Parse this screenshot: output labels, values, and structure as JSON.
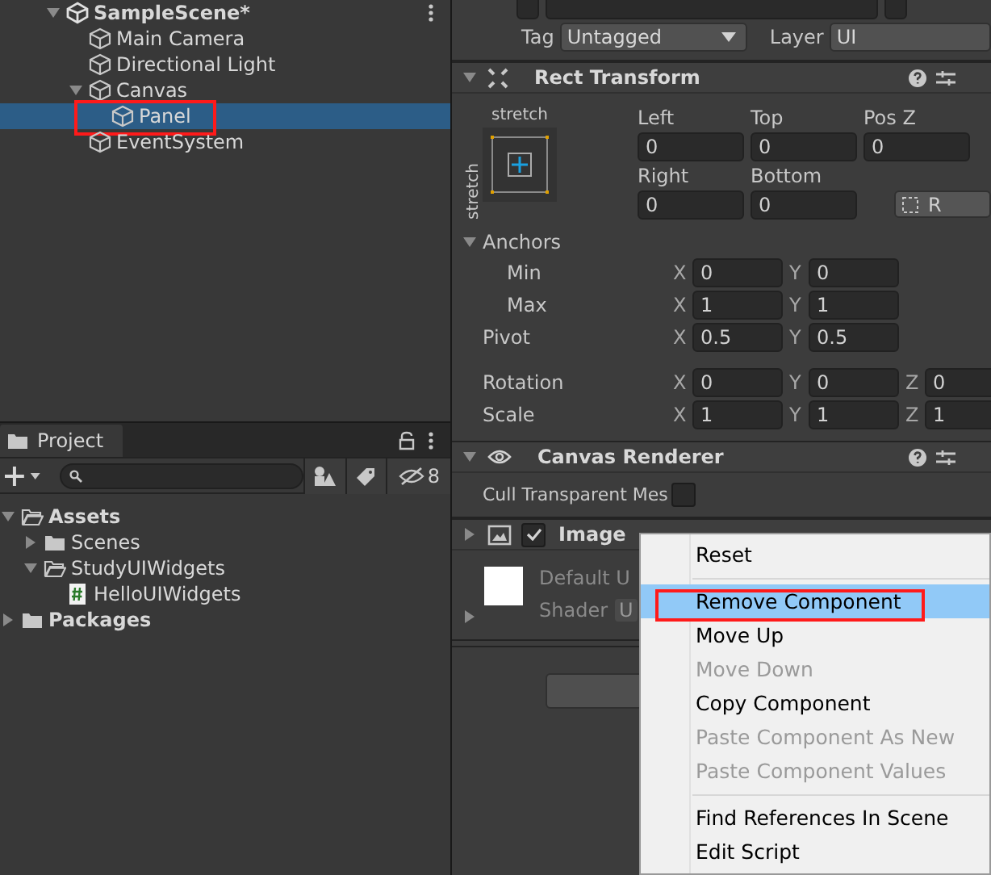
{
  "hierarchy": {
    "items": [
      {
        "name": "SampleScene*",
        "kind": "scene",
        "expanded": true,
        "selected": false,
        "annotated": false,
        "children": [
          {
            "name": "Main Camera",
            "kind": "object",
            "selected": false,
            "annotated": false
          },
          {
            "name": "Directional Light",
            "kind": "object",
            "selected": false,
            "annotated": false
          },
          {
            "name": "Canvas",
            "kind": "object",
            "expanded": true,
            "selected": false,
            "annotated": false,
            "children": [
              {
                "name": "Panel",
                "kind": "object",
                "selected": true,
                "annotated": true
              }
            ]
          },
          {
            "name": "EventSystem",
            "kind": "object",
            "selected": false,
            "annotated": false
          }
        ]
      }
    ]
  },
  "project": {
    "tab": "Project",
    "hidden_count": "8",
    "items": [
      {
        "name": "Assets",
        "kind": "folder",
        "expanded": true,
        "bold": true,
        "children": [
          {
            "name": "Scenes",
            "kind": "folder",
            "expanded": false,
            "bold": false
          },
          {
            "name": "StudyUIWidgets",
            "kind": "folder",
            "expanded": true,
            "bold": false,
            "children": [
              {
                "name": "HelloUIWidgets",
                "kind": "script",
                "bold": false
              }
            ]
          }
        ]
      },
      {
        "name": "Packages",
        "kind": "folder",
        "expanded": false,
        "bold": true
      }
    ]
  },
  "inspector": {
    "tag": {
      "label": "Tag",
      "value": "Untagged"
    },
    "layer": {
      "label": "Layer",
      "value": "UI"
    },
    "rect_transform": {
      "title": "Rect Transform",
      "expanded": true,
      "preset_top": "stretch",
      "preset_side": "stretch",
      "position_rows": [
        [
          {
            "label": "Left",
            "value": "0"
          },
          {
            "label": "Top",
            "value": "0"
          },
          {
            "label": "Pos Z",
            "value": "0"
          }
        ],
        [
          {
            "label": "Right",
            "value": "0"
          },
          {
            "label": "Bottom",
            "value": "0"
          }
        ]
      ],
      "raw_button": "R",
      "anchors": {
        "label": "Anchors",
        "expanded": true,
        "rows": [
          {
            "label": "Min",
            "fields": [
              {
                "axis": "X",
                "value": "0"
              },
              {
                "axis": "Y",
                "value": "0"
              }
            ]
          },
          {
            "label": "Max",
            "fields": [
              {
                "axis": "X",
                "value": "1"
              },
              {
                "axis": "Y",
                "value": "1"
              }
            ]
          }
        ]
      },
      "vectors": [
        {
          "label": "Pivot",
          "fields": [
            {
              "axis": "X",
              "value": "0.5"
            },
            {
              "axis": "Y",
              "value": "0.5"
            }
          ]
        },
        {
          "label": "Rotation",
          "fields": [
            {
              "axis": "X",
              "value": "0"
            },
            {
              "axis": "Y",
              "value": "0"
            },
            {
              "axis": "Z",
              "value": "0"
            }
          ]
        },
        {
          "label": "Scale",
          "fields": [
            {
              "axis": "X",
              "value": "1"
            },
            {
              "axis": "Y",
              "value": "1"
            },
            {
              "axis": "Z",
              "value": "1"
            }
          ]
        }
      ]
    },
    "canvas_renderer": {
      "title": "Canvas Renderer",
      "expanded": true,
      "toggles": [
        {
          "label": "Cull Transparent Mes",
          "checked": false
        }
      ]
    },
    "image": {
      "title": "Image",
      "enabled": true,
      "expanded": false,
      "material": "Default U",
      "shader_label": "Shader",
      "shader_value": "U"
    }
  },
  "context_menu": {
    "items": [
      {
        "kind": "item",
        "label": "Reset",
        "disabled": false,
        "selected": false,
        "annotated": false
      },
      {
        "kind": "separator"
      },
      {
        "kind": "item",
        "label": "Remove Component",
        "disabled": false,
        "selected": true,
        "annotated": true
      },
      {
        "kind": "item",
        "label": "Move Up",
        "disabled": false,
        "selected": false,
        "annotated": false
      },
      {
        "kind": "item",
        "label": "Move Down",
        "disabled": true,
        "selected": false,
        "annotated": false
      },
      {
        "kind": "item",
        "label": "Copy Component",
        "disabled": false,
        "selected": false,
        "annotated": false
      },
      {
        "kind": "item",
        "label": "Paste Component As New",
        "disabled": true,
        "selected": false,
        "annotated": false
      },
      {
        "kind": "item",
        "label": "Paste Component Values",
        "disabled": true,
        "selected": false,
        "annotated": false
      },
      {
        "kind": "separator"
      },
      {
        "kind": "item",
        "label": "Find References In Scene",
        "disabled": false,
        "selected": false,
        "annotated": false
      },
      {
        "kind": "item",
        "label": "Edit Script",
        "disabled": false,
        "selected": false,
        "annotated": false
      }
    ]
  }
}
